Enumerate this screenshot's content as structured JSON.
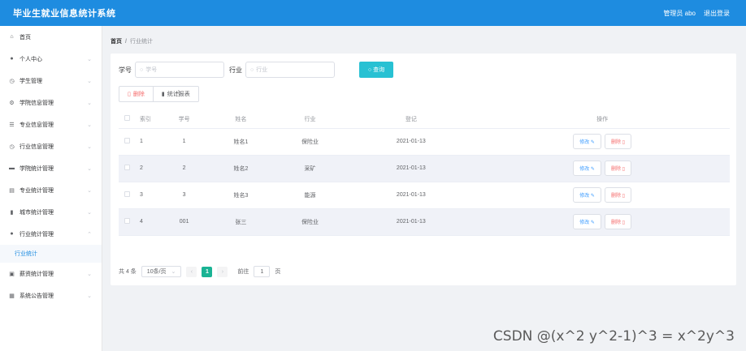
{
  "header": {
    "title": "毕业生就业信息统计系统",
    "user": "管理员 abo",
    "logout": "退出登录"
  },
  "sidebar": {
    "items": [
      {
        "label": "首页",
        "icon": "home-icon",
        "chev": ""
      },
      {
        "label": "个人中心",
        "icon": "user-icon",
        "chev": "⌄"
      },
      {
        "label": "学生管理",
        "icon": "clock-icon",
        "chev": "⌄"
      },
      {
        "label": "学院信息管理",
        "icon": "gear-icon",
        "chev": "⌄"
      },
      {
        "label": "专业信息管理",
        "icon": "sliders-icon",
        "chev": "⌄"
      },
      {
        "label": "行业信息管理",
        "icon": "clock-icon",
        "chev": "⌄"
      },
      {
        "label": "学院统计管理",
        "icon": "briefcase-icon",
        "chev": "⌄"
      },
      {
        "label": "专业统计管理",
        "icon": "document-icon",
        "chev": "⌄"
      },
      {
        "label": "城市统计管理",
        "icon": "bar-chart-icon",
        "chev": "⌄"
      },
      {
        "label": "行业统计管理",
        "icon": "location-icon",
        "chev": "⌃"
      }
    ],
    "sub_active": "行业统计",
    "items_after": [
      {
        "label": "薪资统计管理",
        "icon": "wallet-icon",
        "chev": "⌄"
      },
      {
        "label": "系统公告管理",
        "icon": "notice-icon",
        "chev": "⌄"
      }
    ]
  },
  "breadcrumb": {
    "home": "首页",
    "separator": "/",
    "current": "行业统计"
  },
  "search": {
    "xuehao_label": "学号",
    "xuehao_placeholder": "学号",
    "hangye_label": "行业",
    "hangye_placeholder": "行业",
    "query_button": "查询"
  },
  "actions": {
    "delete": "删除",
    "stat": "统计报表"
  },
  "table": {
    "headers": [
      "",
      "索引",
      "学号",
      "姓名",
      "行业",
      "登记",
      "操作"
    ],
    "rows": [
      {
        "idx": "1",
        "xuehao": "1",
        "name": "姓名1",
        "industry": "保险业",
        "date": "2021-01-13"
      },
      {
        "idx": "2",
        "xuehao": "2",
        "name": "姓名2",
        "industry": "采矿",
        "date": "2021-01-13"
      },
      {
        "idx": "3",
        "xuehao": "3",
        "name": "姓名3",
        "industry": "能源",
        "date": "2021-01-13"
      },
      {
        "idx": "4",
        "xuehao": "001",
        "name": "张三",
        "industry": "保险业",
        "date": "2021-01-13"
      }
    ],
    "edit_label": "修改",
    "delete_label": "删除"
  },
  "pagination": {
    "total": "共 4 条",
    "page_size": "10条/页",
    "current_page": "1",
    "goto_label": "前往",
    "goto_value": "1",
    "page_unit": "页"
  },
  "watermark": "CSDN @(x^2 y^2-1)^3 = x^2y^3",
  "colors": {
    "header": "#1e8ce0",
    "accent": "#28c1d3",
    "page_active": "#1ab394",
    "danger": "#f56c6c"
  }
}
